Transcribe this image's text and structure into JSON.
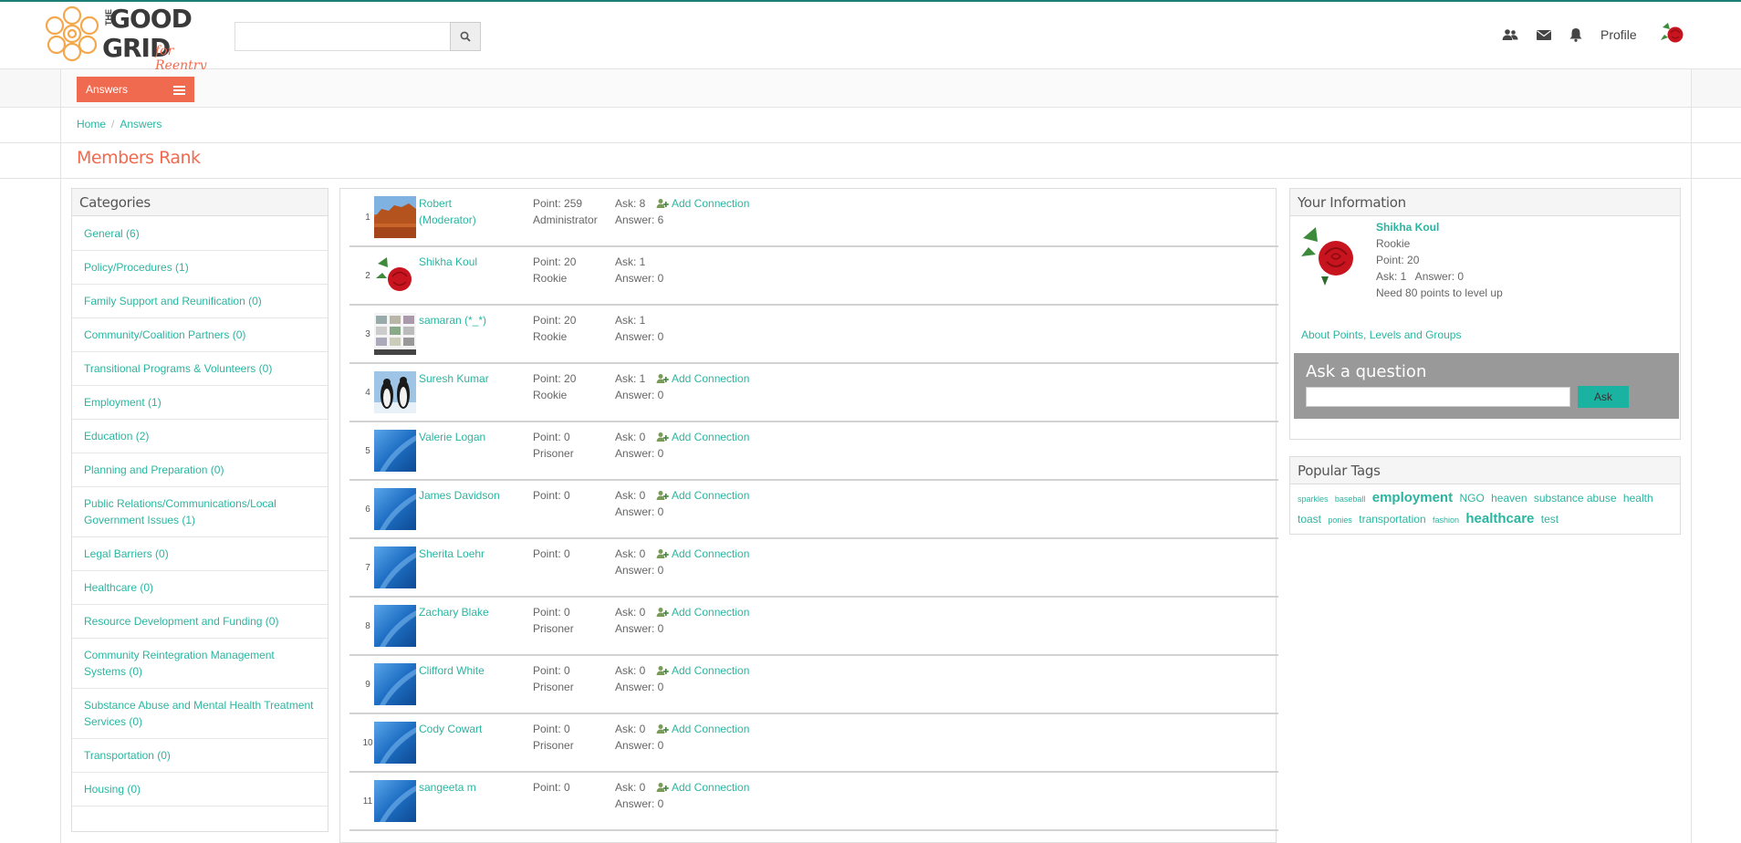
{
  "header": {
    "logo": {
      "the": "THE",
      "good": "GOOD",
      "grid": "GRID",
      "tagline": "for Reentry"
    },
    "search": {
      "placeholder": "",
      "value": ""
    },
    "profile_label": "Profile",
    "icons": [
      "users-icon",
      "envelope-icon",
      "bell-icon"
    ]
  },
  "nav": {
    "answers_label": "Answers"
  },
  "breadcrumb": {
    "home": "Home",
    "current": "Answers",
    "separator": "/"
  },
  "page": {
    "title": "Members Rank"
  },
  "categories": {
    "title": "Categories",
    "items": [
      "General (6)",
      "Policy/Procedures (1)",
      "Family Support and Reunification (0)",
      "Community/Coalition Partners (0)",
      "Transitional Programs & Volunteers (0)",
      "Employment (1)",
      "Education (2)",
      "Planning and Preparation (0)",
      "Public Relations/Communications/Local Government Issues (1)",
      "Legal Barriers (0)",
      "Healthcare (0)",
      "Resource Development and Funding (0)",
      "Community Reintegration Management Systems (0)",
      "Substance Abuse and Mental Health Treatment Services (0)",
      "Transportation (0)",
      "Housing (0)"
    ]
  },
  "members": [
    {
      "rank": "1",
      "name": "Robert (Moderator)",
      "point": "Point: 259",
      "level": "Administrator",
      "ask": "Ask: 8",
      "answer": "Answer: 6",
      "connect": "Add Connection",
      "avatar": "canyon"
    },
    {
      "rank": "2",
      "name": "Shikha Koul",
      "point": "Point: 20",
      "level": "Rookie",
      "ask": "Ask: 1",
      "answer": "Answer: 0",
      "connect": "",
      "avatar": "rose"
    },
    {
      "rank": "3",
      "name": "samaran (*_*)",
      "point": "Point: 20",
      "level": "Rookie",
      "ask": "Ask: 1",
      "answer": "Answer: 0",
      "connect": "",
      "avatar": "screens"
    },
    {
      "rank": "4",
      "name": "Suresh Kumar",
      "point": "Point: 20",
      "level": "Rookie",
      "ask": "Ask: 1",
      "answer": "Answer: 0",
      "connect": "Add Connection",
      "avatar": "penguins"
    },
    {
      "rank": "5",
      "name": "Valerie Logan",
      "point": "Point: 0",
      "level": "Prisoner",
      "ask": "Ask: 0",
      "answer": "Answer: 0",
      "connect": "Add Connection",
      "avatar": "blue"
    },
    {
      "rank": "6",
      "name": "James Davidson",
      "point": "Point: 0",
      "level": "",
      "ask": "Ask: 0",
      "answer": "Answer: 0",
      "connect": "Add Connection",
      "avatar": "blue"
    },
    {
      "rank": "7",
      "name": "Sherita Loehr",
      "point": "Point: 0",
      "level": "",
      "ask": "Ask: 0",
      "answer": "Answer: 0",
      "connect": "Add Connection",
      "avatar": "blue"
    },
    {
      "rank": "8",
      "name": "Zachary Blake",
      "point": "Point: 0",
      "level": "Prisoner",
      "ask": "Ask: 0",
      "answer": "Answer: 0",
      "connect": "Add Connection",
      "avatar": "blue"
    },
    {
      "rank": "9",
      "name": "Clifford White",
      "point": "Point: 0",
      "level": "Prisoner",
      "ask": "Ask: 0",
      "answer": "Answer: 0",
      "connect": "Add Connection",
      "avatar": "blue"
    },
    {
      "rank": "10",
      "name": "Cody Cowart",
      "point": "Point: 0",
      "level": "Prisoner",
      "ask": "Ask: 0",
      "answer": "Answer: 0",
      "connect": "Add Connection",
      "avatar": "blue"
    },
    {
      "rank": "11",
      "name": "sangeeta m",
      "point": "Point: 0",
      "level": "",
      "ask": "Ask: 0",
      "answer": "Answer: 0",
      "connect": "Add Connection",
      "avatar": "blue"
    }
  ],
  "your_info": {
    "title": "Your Information",
    "name": "Shikha Koul",
    "level": "Rookie",
    "point": "Point: 20",
    "ask_answer": "Ask: 1   Answer: 0",
    "need": "Need 80 points to level up",
    "about_link": "About Points, Levels and Groups",
    "ask_title": "Ask a question",
    "ask_placeholder": "",
    "ask_button": "Ask"
  },
  "popular_tags": {
    "title": "Popular Tags",
    "tags": [
      {
        "label": "sparkles",
        "size": "s"
      },
      {
        "label": "baseball",
        "size": "s"
      },
      {
        "label": "employment",
        "size": "xl"
      },
      {
        "label": "NGO",
        "size": "m"
      },
      {
        "label": "heaven",
        "size": "m"
      },
      {
        "label": "substance abuse",
        "size": "m"
      },
      {
        "label": "health",
        "size": "m"
      },
      {
        "label": "toast",
        "size": "m"
      },
      {
        "label": "ponies",
        "size": "s"
      },
      {
        "label": "transportation",
        "size": "m"
      },
      {
        "label": "fashion",
        "size": "s"
      },
      {
        "label": "healthcare",
        "size": "xl"
      },
      {
        "label": "test",
        "size": "m"
      }
    ]
  },
  "colors": {
    "accent": "#f06a50",
    "link": "#2bb5a0",
    "button": "#1ab3a1",
    "ask_box": "#999999"
  }
}
